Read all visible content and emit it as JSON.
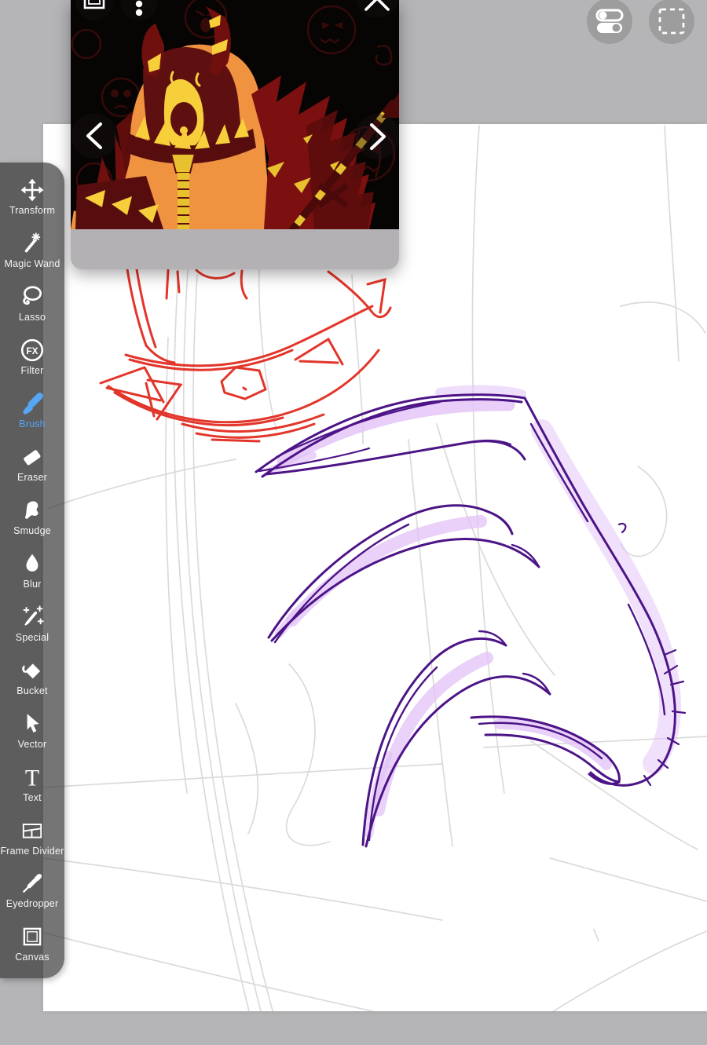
{
  "colors": {
    "background": "#b5b4b6",
    "canvas": "#ffffff",
    "sidebar_bg": "rgba(52,52,52,0.68)",
    "accent_blue": "#55a7f5",
    "sketch_red": "#e0251a",
    "sketch_purple": "#4c1486",
    "sketch_glow": "#e2c2f7",
    "construction_gray": "#d9d9d9",
    "panel_footer": "#b4b1b5",
    "round_button_gray": "#9d9d9d"
  },
  "sidebar": {
    "selected_tool": "Brush",
    "tools": [
      {
        "label": "Transform",
        "icon": "move-arrows-icon"
      },
      {
        "label": "Magic Wand",
        "icon": "magic-wand-icon"
      },
      {
        "label": "Lasso",
        "icon": "lasso-icon"
      },
      {
        "label": "Filter",
        "icon": "fx-circle-icon",
        "icon_text": "FX"
      },
      {
        "label": "Brush",
        "icon": "brush-icon",
        "selected": true
      },
      {
        "label": "Eraser",
        "icon": "eraser-icon"
      },
      {
        "label": "Smudge",
        "icon": "smudge-finger-icon"
      },
      {
        "label": "Blur",
        "icon": "water-drop-icon"
      },
      {
        "label": "Special",
        "icon": "sparkle-pen-icon"
      },
      {
        "label": "Bucket",
        "icon": "paint-bucket-icon"
      },
      {
        "label": "Vector",
        "icon": "cursor-arrow-icon"
      },
      {
        "label": "Text",
        "icon": "text-icon",
        "icon_text": "T"
      },
      {
        "label": "Frame Divider",
        "icon": "frame-divider-icon"
      },
      {
        "label": "Eyedropper",
        "icon": "eyedropper-icon"
      },
      {
        "label": "Canvas",
        "icon": "canvas-square-icon"
      }
    ]
  },
  "reference_panel": {
    "icons": {
      "fullscreen": "nested-square",
      "menu": "vertical-ellipsis",
      "close": "x-cross",
      "prev": "chevron-left",
      "next": "chevron-right"
    }
  },
  "header_buttons": [
    {
      "name": "layer-toggles-button",
      "icon": "toggle-switches"
    },
    {
      "name": "selection-tool-button",
      "icon": "dashed-square"
    }
  ]
}
